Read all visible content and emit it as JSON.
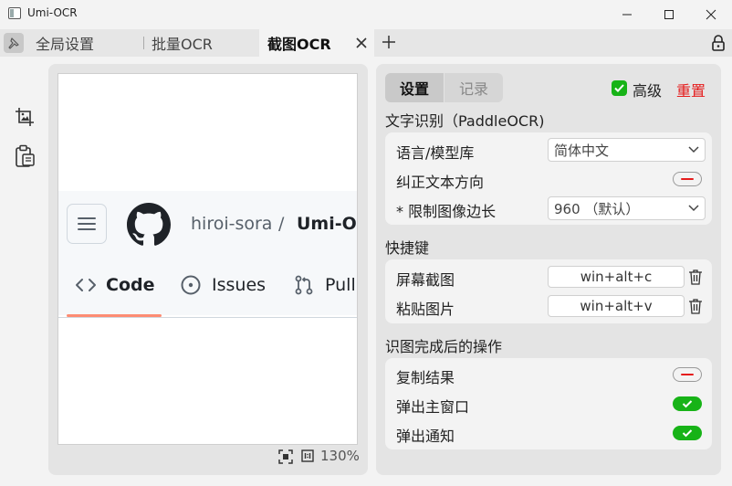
{
  "window": {
    "title": "Umi-OCR"
  },
  "tabs": [
    {
      "label": "全局设置",
      "active": false
    },
    {
      "label": "批量OCR",
      "active": false
    },
    {
      "label": "截图OCR",
      "active": true
    }
  ],
  "preview": {
    "github": {
      "owner": "hiroi-sora",
      "slash": "/",
      "repo": "Umi-OC",
      "tabs": [
        "Code",
        "Issues",
        "Pull"
      ]
    },
    "zoom": "130%"
  },
  "settings": {
    "segments": {
      "settings": "设置",
      "records": "记录"
    },
    "advanced": {
      "label": "高级",
      "checked": true
    },
    "reset_label": "重置",
    "sections": {
      "ocr": {
        "title": "文字识别（PaddleOCR)",
        "language_label": "语言/模型库",
        "language_value": "简体中文",
        "direction_label": "纠正文本方向",
        "direction_enabled": false,
        "limit_label": "* 限制图像边长",
        "limit_value": "960 （默认）"
      },
      "hotkeys": {
        "title": "快捷键",
        "screenshot_label": "屏幕截图",
        "screenshot_value": "win+alt+c",
        "paste_label": "粘贴图片",
        "paste_value": "win+alt+v"
      },
      "after": {
        "title": "识图完成后的操作",
        "copy_label": "复制结果",
        "copy_enabled": false,
        "popup_label": "弹出主窗口",
        "popup_enabled": true,
        "notify_label": "弹出通知",
        "notify_enabled": true
      }
    }
  },
  "colors": {
    "accent_green": "#17b317",
    "reset_red": "#e51c1c",
    "github_orange": "#fd8c73"
  }
}
